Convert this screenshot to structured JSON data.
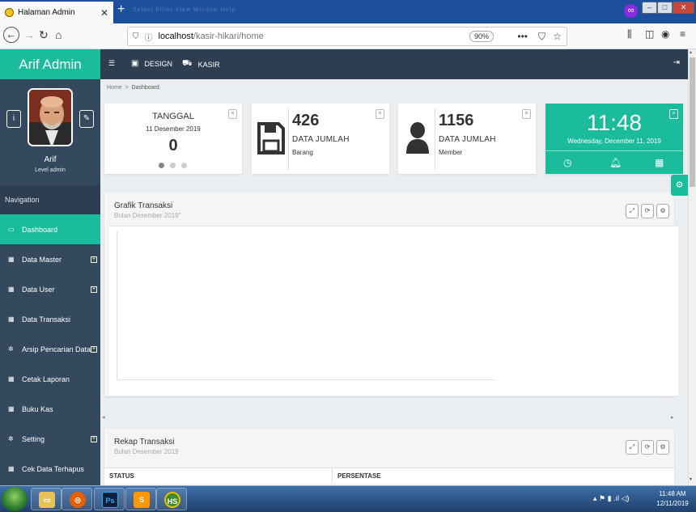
{
  "browser": {
    "tab_title": "Halaman Admin",
    "tab_close": "✕",
    "new_tab": "+",
    "faint_menu": "Select  Filter  View  Window  Help",
    "url_host": "localhost",
    "url_path": "/kasir-hikari/home",
    "zoom": "90%"
  },
  "app": {
    "brand": "Arif Admin",
    "top_menu": [
      {
        "label": "DESIGN"
      },
      {
        "label": "KASIR"
      }
    ]
  },
  "profile": {
    "name": "Arif",
    "role": "Level admin"
  },
  "sidebar": {
    "heading": "Navigation",
    "items": [
      {
        "label": "Dashboard",
        "icon": "monitor-icon"
      },
      {
        "label": "Data Master",
        "icon": "grid-icon"
      },
      {
        "label": "Data User",
        "icon": "grid-icon"
      },
      {
        "label": "Data Transaksi",
        "icon": "grid-icon"
      },
      {
        "label": "Arsip Pencarian Data",
        "icon": "gears-icon"
      },
      {
        "label": "Cetak Laporan",
        "icon": "grid-icon"
      },
      {
        "label": "Buku Kas",
        "icon": "grid-icon"
      },
      {
        "label": "Setting",
        "icon": "gears-icon"
      },
      {
        "label": "Cek Data Terhapus",
        "icon": "grid-icon"
      }
    ]
  },
  "breadcrumb": {
    "home": "Home",
    "separator": ">",
    "current": "Dashboard"
  },
  "widgets": {
    "tanggal": {
      "title": "TANGGAL",
      "date": "11 Desember 2019",
      "value": "0"
    },
    "barang": {
      "number": "426",
      "label": "DATA JUMLAH",
      "sub": "Barang"
    },
    "member": {
      "number": "1156",
      "label": "DATA JUMLAH",
      "sub": "Member"
    },
    "clock": {
      "time": "11:48",
      "date": "Wednesday, December 11, 2019"
    },
    "close_symbol": "×"
  },
  "grafik": {
    "title": "Grafik Transaksi",
    "subtitle": "Bulan Desember 2019\""
  },
  "rekap": {
    "title": "Rekap Transaksi",
    "subtitle": "Bulan Desember 2019",
    "columns": [
      "STATUS",
      "PERSENTASE"
    ]
  },
  "taskbar": {
    "time": "11:48 AM",
    "date": "12/11/2019"
  },
  "colors": {
    "accent": "#1abc9c",
    "sidebar": "#34495e",
    "topbar": "#2c3e50"
  }
}
